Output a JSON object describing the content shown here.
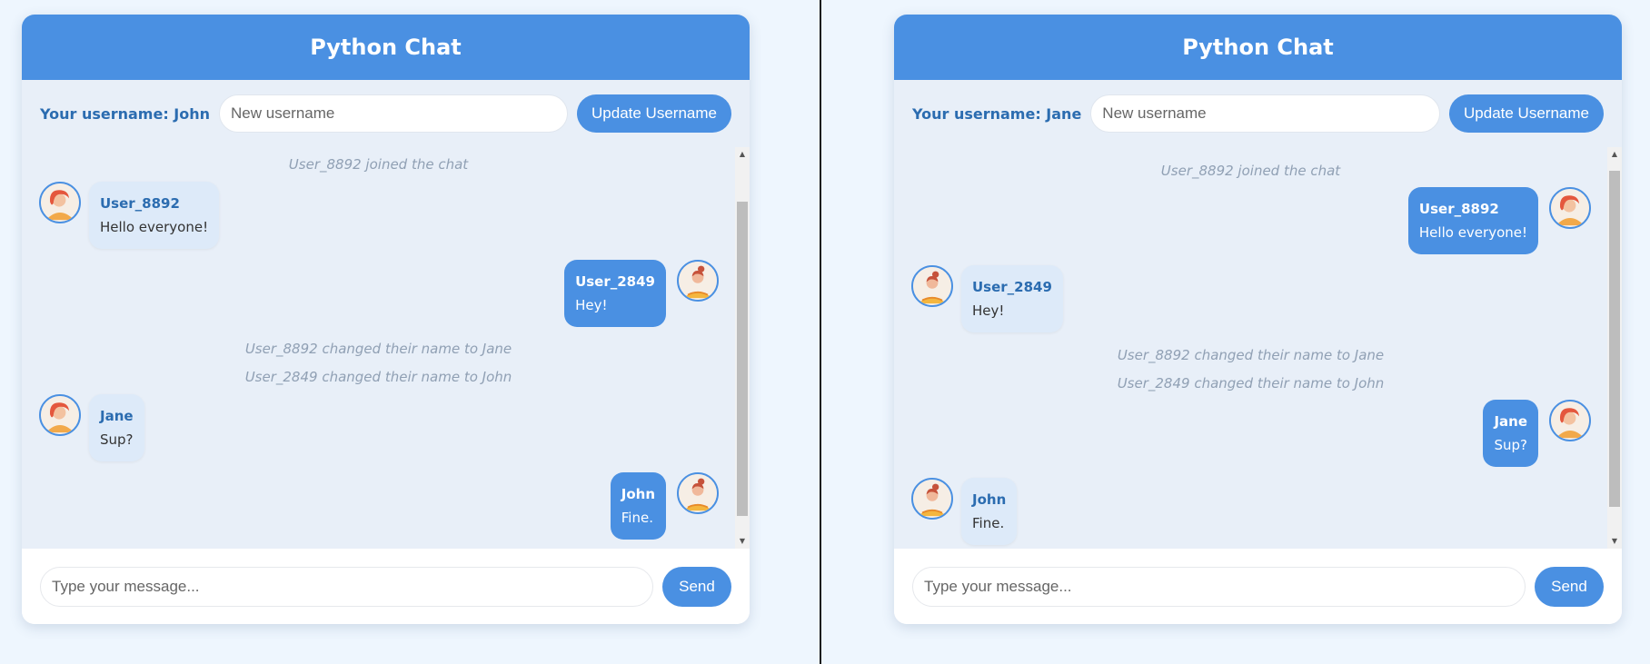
{
  "panels": [
    {
      "title": "Python Chat",
      "username_label": "Your username: John",
      "username_placeholder": "New username",
      "update_button": "Update Username",
      "message_placeholder": "Type your message...",
      "send_button": "Send",
      "system_messages": [
        "User_8892 joined the chat",
        "User_8892 changed their name to Jane",
        "User_2849 changed their name to John"
      ],
      "messages": [
        {
          "sender": "User_8892",
          "text": "Hello everyone!",
          "side": "incoming",
          "avatar": "red-hair-woman-avatar"
        },
        {
          "sender": "User_2849",
          "text": "Hey!",
          "side": "outgoing",
          "avatar": "bun-hair-woman-avatar"
        },
        {
          "sender": "Jane",
          "text": "Sup?",
          "side": "incoming",
          "avatar": "red-hair-woman-avatar"
        },
        {
          "sender": "John",
          "text": "Fine.",
          "side": "outgoing",
          "avatar": "bun-hair-woman-avatar"
        }
      ]
    },
    {
      "title": "Python Chat",
      "username_label": "Your username: Jane",
      "username_placeholder": "New username",
      "update_button": "Update Username",
      "message_placeholder": "Type your message...",
      "send_button": "Send",
      "system_messages": [
        "User_8892 joined the chat",
        "User_8892 changed their name to Jane",
        "User_2849 changed their name to John"
      ],
      "messages": [
        {
          "sender": "User_8892",
          "text": "Hello everyone!",
          "side": "outgoing",
          "avatar": "red-hair-woman-avatar"
        },
        {
          "sender": "User_2849",
          "text": "Hey!",
          "side": "incoming",
          "avatar": "bun-hair-woman-avatar"
        },
        {
          "sender": "Jane",
          "text": "Sup?",
          "side": "outgoing",
          "avatar": "red-hair-woman-avatar"
        },
        {
          "sender": "John",
          "text": "Fine.",
          "side": "incoming",
          "avatar": "bun-hair-woman-avatar"
        }
      ]
    }
  ],
  "colors": {
    "accent": "#4a90e2",
    "panel_bg": "#e8eff8",
    "page_bg": "#eef6fe",
    "sender_name": "#2b6cb0"
  }
}
